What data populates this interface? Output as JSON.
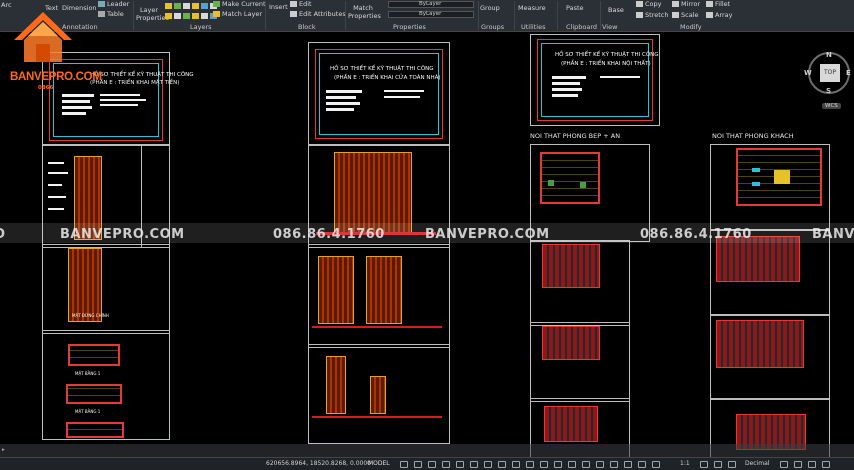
{
  "ribbon": {
    "annotation_tools": [
      "Text",
      "Dimension",
      "Leader",
      "Table"
    ],
    "layer_tools": [
      "Layer Properties",
      "Make Current",
      "Match Layer"
    ],
    "block_tools": [
      "Insert",
      "Edit",
      "Edit Attributes"
    ],
    "properties_tools": [
      "Match Properties"
    ],
    "bylayer_1": "ByLayer",
    "bylayer_2": "ByLayer",
    "groups_tool": "Group",
    "utilities_tool": "Measure",
    "clipboard_tools": [
      "Paste",
      "Copy"
    ],
    "view_tool": "Base",
    "modify_tools": [
      "Mirror",
      "Fillet",
      "Stretch",
      "Scale",
      "Array"
    ],
    "groups": [
      "Annotation",
      "Layers",
      "Block",
      "Properties",
      "Groups",
      "Utilities",
      "Clipboard",
      "View",
      "Modify"
    ],
    "arc_label": "Arc"
  },
  "logo": {
    "text": "BANVEPRO.COM",
    "sub": "0866"
  },
  "drawing": {
    "sheet1_title": "HỒ SƠ THIẾT KẾ KỸ THUẬT THI CÔNG",
    "sheet1_sub": "(PHẦN E : TRIỂN KHAI MẶT TIỀN)",
    "sheet2_title": "HỒ SƠ THIẾT KẾ KỸ THUẬT THI CÔNG",
    "sheet2_sub": "(PHẦN E : TRIỂN KHAI CỬA TOÀN NHÀ)",
    "sheet3_title": "HỒ SƠ THIẾT KẾ KỸ THUẬT THI CÔNG",
    "sheet3_sub": "(PHẦN E : TRIỂN KHAI NỘI THẤT)",
    "section_kitchen": "NOI THAT PHONG BEP + AN",
    "section_living": "NOI THAT PHONG KHACH",
    "label_mat_dung": "MẶT ĐỨNG CHÍNH",
    "label_mat_bang1": "MẶT BẰNG 1",
    "label_mat_bang2": "MẶT BẰNG 1"
  },
  "watermark": {
    "phone": "086.86.4.1760",
    "site": "BANVEPRO.COM"
  },
  "viewcube": {
    "top": "TOP",
    "n": "N",
    "s": "S",
    "e": "E",
    "w": "W",
    "wcs": "WCS"
  },
  "statusbar": {
    "coords": "620656.8964, 18520.8268, 0.0000",
    "model": "MODEL",
    "scale": "1:1",
    "units": "Decimal"
  }
}
